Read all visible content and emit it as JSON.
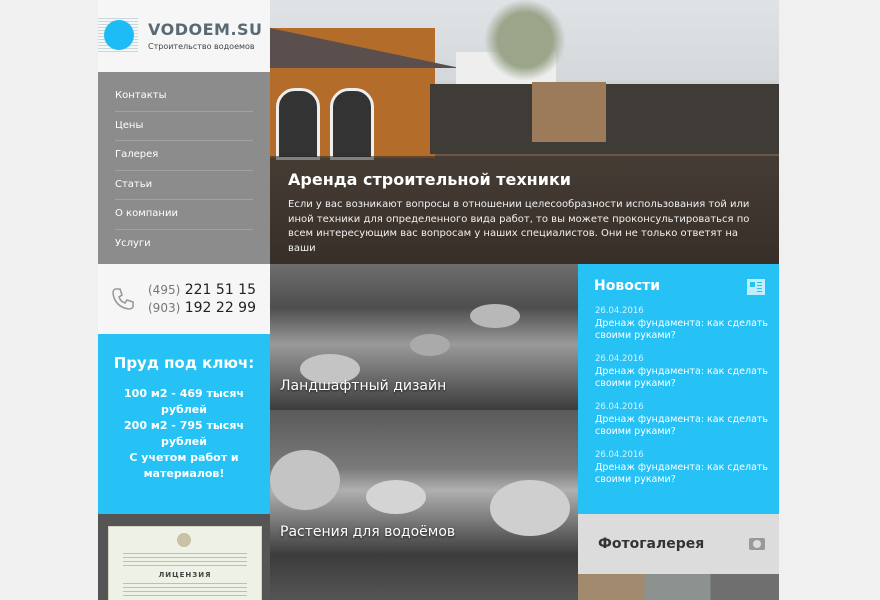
{
  "logo": {
    "brand": "VODOEM.SU",
    "tagline": "Строительство водоемов",
    "accent": "#1ebcf6"
  },
  "menu": {
    "items": [
      "Контакты",
      "Цены",
      "Галерея",
      "Статьи",
      "О компании",
      "Услуги"
    ]
  },
  "phones": [
    {
      "code": "(495)",
      "number": "221 51 15"
    },
    {
      "code": "(903)",
      "number": "192 22 99"
    }
  ],
  "promo": {
    "title": "Пруд под ключ:",
    "lines": [
      "100 м2 - 469 тысяч рублей",
      "200 м2 - 795 тысяч рублей",
      "С учетом работ и материалов!"
    ]
  },
  "license": {
    "heading": "ЛИЦЕНЗИЯ"
  },
  "hero": {
    "title": "Аренда строительной техники",
    "text": "Если у вас возникают вопросы в отношении целесообразности использования той или иной техники для определенного вида работ, то вы можете проконсультироваться по всем интересующим вас вопросам у наших специалистов. Они не только ответят на ваши"
  },
  "tiles": [
    {
      "label": "Ландшафтный дизайн"
    },
    {
      "label": "Растения для водоёмов"
    }
  ],
  "news": {
    "heading": "Новости",
    "items": [
      {
        "date": "26.04.2016",
        "title": "Дренаж фундамента: как сделать своими руками?"
      },
      {
        "date": "26.04.2016",
        "title": "Дренаж фундамента: как сделать своими руками?"
      },
      {
        "date": "26.04.2016",
        "title": "Дренаж фундамента: как сделать своими руками?"
      },
      {
        "date": "26.04.2016",
        "title": "Дренаж фундамента: как сделать своими руками?"
      }
    ],
    "color": "#26c1f5"
  },
  "gallery": {
    "heading": "Фотогалерея",
    "icon": "camera-icon"
  }
}
